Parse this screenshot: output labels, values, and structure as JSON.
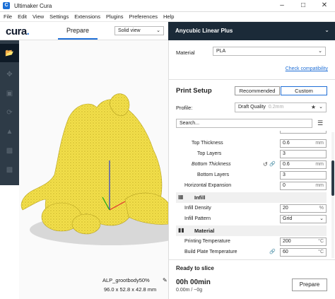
{
  "window": {
    "title": "Ultimaker Cura",
    "app_icon": "cura-app-icon",
    "controls": [
      "minimize",
      "maximize",
      "close"
    ]
  },
  "menu": [
    "File",
    "Edit",
    "View",
    "Settings",
    "Extensions",
    "Plugins",
    "Preferences",
    "Help"
  ],
  "header": {
    "logo": "cura",
    "tab_prepare": "Prepare",
    "view_mode": "Solid view"
  },
  "printer": {
    "name": "Anycubic Linear Plus"
  },
  "left_tools": [
    "open-folder-icon",
    "move-icon",
    "scale-icon",
    "rotate-icon",
    "mirror-icon",
    "per-model-settings-icon",
    "support-blocker-icon"
  ],
  "model": {
    "name": "ALP_grootbody50%",
    "dimensions": "96.0 x 52.8 x 42.8 mm"
  },
  "panel": {
    "material_label": "Material",
    "material_value": "PLA",
    "check_compat": "Check compatibility",
    "print_setup": "Print Setup",
    "recommended": "Recommended",
    "custom": "Custom",
    "profile_label": "Profile:",
    "profile_value": "Draft Quality",
    "profile_sub": "0.2mm",
    "search_placeholder": "Search..."
  },
  "settings": [
    {
      "label": "Top Thickness",
      "value": "0.6",
      "unit": "mm"
    },
    {
      "label": "Top Layers",
      "value": "3",
      "unit": ""
    },
    {
      "label": "Bottom Thickness",
      "value": "0.6",
      "unit": "mm"
    },
    {
      "label": "Bottom Layers",
      "value": "3",
      "unit": ""
    },
    {
      "label": "Horizontal Expansion",
      "value": "0",
      "unit": "mm"
    },
    {
      "label": "Infill",
      "category": true
    },
    {
      "label": "Infill Density",
      "value": "20",
      "unit": "%"
    },
    {
      "label": "Infill Pattern",
      "value": "Grid",
      "unit": ""
    },
    {
      "label": "Material",
      "category": true
    },
    {
      "label": "Printing Temperature",
      "value": "200",
      "unit": "°C"
    },
    {
      "label": "Build Plate Temperature",
      "value": "60",
      "unit": "°C"
    }
  ],
  "slice": {
    "status": "Ready to slice",
    "time": "00h 00min",
    "usage": "0.00m / ~0g",
    "button": "Prepare"
  },
  "colors": {
    "accent": "#1f6ed6",
    "dark": "#1b2a38",
    "toolbar": "#2e3b47",
    "model": "#f5e14b"
  }
}
